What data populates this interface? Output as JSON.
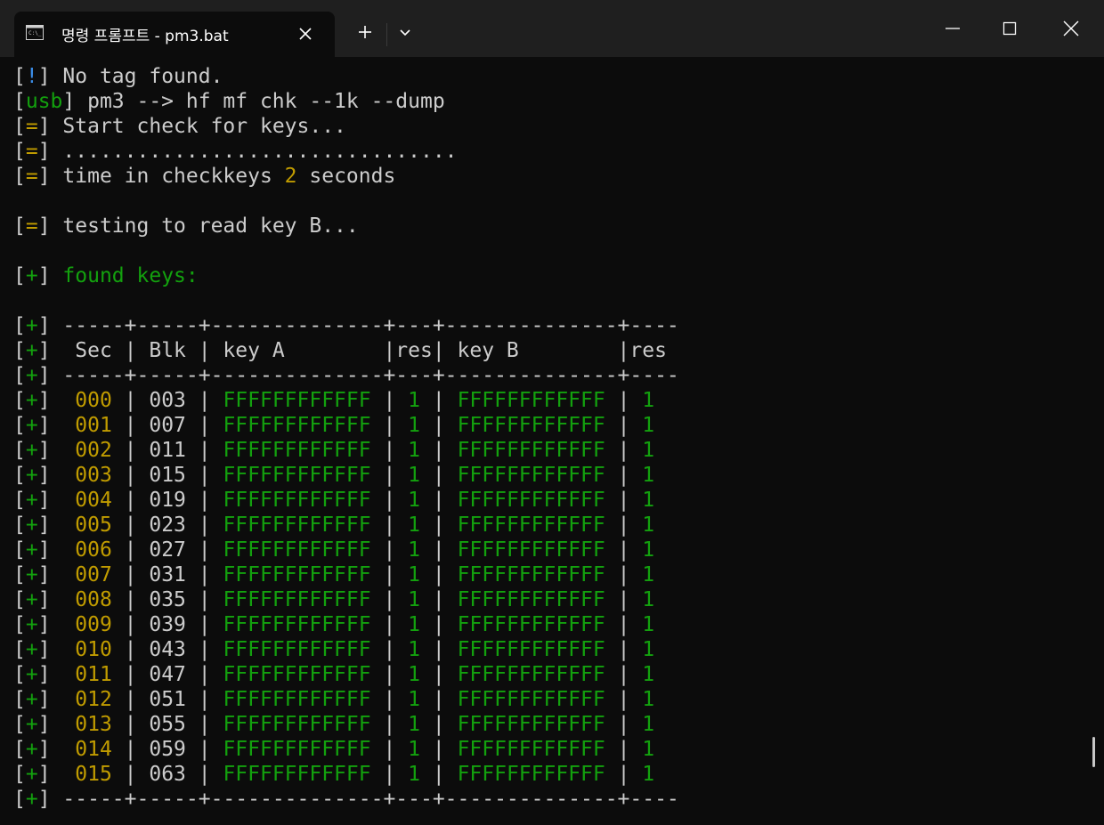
{
  "window": {
    "tab_title": "명령 프롬프트 - pm3.bat",
    "new_tab_label": "+",
    "icons": {
      "tab": "terminal-icon",
      "close_tab": "close-icon",
      "dropdown": "chevron-down-icon",
      "minimize": "minimize-icon",
      "maximize": "maximize-icon",
      "close_window": "close-icon"
    }
  },
  "colors": {
    "background": "#0c0c0c",
    "titlebar": "#1f1f1f",
    "text": "#cccccc",
    "green": "#13a10e",
    "yellow": "#c19c00",
    "blue": "#3b8eea"
  },
  "terminal": {
    "lines": [
      [
        {
          "t": "[",
          "c": "white"
        },
        {
          "t": "!",
          "c": "blue"
        },
        {
          "t": "] No tag found.",
          "c": "white"
        }
      ],
      [
        {
          "t": "[",
          "c": "white"
        },
        {
          "t": "usb",
          "c": "green"
        },
        {
          "t": "] pm3 --> hf mf chk --1k --dump",
          "c": "white"
        }
      ],
      [
        {
          "t": "[",
          "c": "white"
        },
        {
          "t": "=",
          "c": "yellow"
        },
        {
          "t": "] Start check for keys...",
          "c": "white"
        }
      ],
      [
        {
          "t": "[",
          "c": "white"
        },
        {
          "t": "=",
          "c": "yellow"
        },
        {
          "t": "] ................................",
          "c": "white"
        }
      ],
      [
        {
          "t": "[",
          "c": "white"
        },
        {
          "t": "=",
          "c": "yellow"
        },
        {
          "t": "] time in checkkeys ",
          "c": "white"
        },
        {
          "t": "2",
          "c": "yellow"
        },
        {
          "t": " seconds",
          "c": "white"
        }
      ],
      [],
      [
        {
          "t": "[",
          "c": "white"
        },
        {
          "t": "=",
          "c": "yellow"
        },
        {
          "t": "] testing to read key B...",
          "c": "white"
        }
      ],
      [],
      [
        {
          "t": "[",
          "c": "white"
        },
        {
          "t": "+",
          "c": "green"
        },
        {
          "t": "] ",
          "c": "white"
        },
        {
          "t": "found keys:",
          "c": "green"
        }
      ],
      [],
      [
        {
          "t": "[",
          "c": "white"
        },
        {
          "t": "+",
          "c": "green"
        },
        {
          "t": "] -----+-----+--------------+---+--------------+----",
          "c": "white"
        }
      ],
      [
        {
          "t": "[",
          "c": "white"
        },
        {
          "t": "+",
          "c": "green"
        },
        {
          "t": "]  Sec | Blk | key A        |res| key B        |res",
          "c": "white"
        }
      ],
      [
        {
          "t": "[",
          "c": "white"
        },
        {
          "t": "+",
          "c": "green"
        },
        {
          "t": "] -----+-----+--------------+---+--------------+----",
          "c": "white"
        }
      ],
      [
        {
          "t": "[",
          "c": "white"
        },
        {
          "t": "+",
          "c": "green"
        },
        {
          "t": "]  ",
          "c": "white"
        },
        {
          "t": "000",
          "c": "yellow"
        },
        {
          "t": " | 003 | ",
          "c": "white"
        },
        {
          "t": "FFFFFFFFFFFF",
          "c": "green"
        },
        {
          "t": " | ",
          "c": "white"
        },
        {
          "t": "1",
          "c": "green"
        },
        {
          "t": " | ",
          "c": "white"
        },
        {
          "t": "FFFFFFFFFFFF",
          "c": "green"
        },
        {
          "t": " | ",
          "c": "white"
        },
        {
          "t": "1",
          "c": "green"
        }
      ],
      [
        {
          "t": "[",
          "c": "white"
        },
        {
          "t": "+",
          "c": "green"
        },
        {
          "t": "]  ",
          "c": "white"
        },
        {
          "t": "001",
          "c": "yellow"
        },
        {
          "t": " | 007 | ",
          "c": "white"
        },
        {
          "t": "FFFFFFFFFFFF",
          "c": "green"
        },
        {
          "t": " | ",
          "c": "white"
        },
        {
          "t": "1",
          "c": "green"
        },
        {
          "t": " | ",
          "c": "white"
        },
        {
          "t": "FFFFFFFFFFFF",
          "c": "green"
        },
        {
          "t": " | ",
          "c": "white"
        },
        {
          "t": "1",
          "c": "green"
        }
      ],
      [
        {
          "t": "[",
          "c": "white"
        },
        {
          "t": "+",
          "c": "green"
        },
        {
          "t": "]  ",
          "c": "white"
        },
        {
          "t": "002",
          "c": "yellow"
        },
        {
          "t": " | 011 | ",
          "c": "white"
        },
        {
          "t": "FFFFFFFFFFFF",
          "c": "green"
        },
        {
          "t": " | ",
          "c": "white"
        },
        {
          "t": "1",
          "c": "green"
        },
        {
          "t": " | ",
          "c": "white"
        },
        {
          "t": "FFFFFFFFFFFF",
          "c": "green"
        },
        {
          "t": " | ",
          "c": "white"
        },
        {
          "t": "1",
          "c": "green"
        }
      ],
      [
        {
          "t": "[",
          "c": "white"
        },
        {
          "t": "+",
          "c": "green"
        },
        {
          "t": "]  ",
          "c": "white"
        },
        {
          "t": "003",
          "c": "yellow"
        },
        {
          "t": " | 015 | ",
          "c": "white"
        },
        {
          "t": "FFFFFFFFFFFF",
          "c": "green"
        },
        {
          "t": " | ",
          "c": "white"
        },
        {
          "t": "1",
          "c": "green"
        },
        {
          "t": " | ",
          "c": "white"
        },
        {
          "t": "FFFFFFFFFFFF",
          "c": "green"
        },
        {
          "t": " | ",
          "c": "white"
        },
        {
          "t": "1",
          "c": "green"
        }
      ],
      [
        {
          "t": "[",
          "c": "white"
        },
        {
          "t": "+",
          "c": "green"
        },
        {
          "t": "]  ",
          "c": "white"
        },
        {
          "t": "004",
          "c": "yellow"
        },
        {
          "t": " | 019 | ",
          "c": "white"
        },
        {
          "t": "FFFFFFFFFFFF",
          "c": "green"
        },
        {
          "t": " | ",
          "c": "white"
        },
        {
          "t": "1",
          "c": "green"
        },
        {
          "t": " | ",
          "c": "white"
        },
        {
          "t": "FFFFFFFFFFFF",
          "c": "green"
        },
        {
          "t": " | ",
          "c": "white"
        },
        {
          "t": "1",
          "c": "green"
        }
      ],
      [
        {
          "t": "[",
          "c": "white"
        },
        {
          "t": "+",
          "c": "green"
        },
        {
          "t": "]  ",
          "c": "white"
        },
        {
          "t": "005",
          "c": "yellow"
        },
        {
          "t": " | 023 | ",
          "c": "white"
        },
        {
          "t": "FFFFFFFFFFFF",
          "c": "green"
        },
        {
          "t": " | ",
          "c": "white"
        },
        {
          "t": "1",
          "c": "green"
        },
        {
          "t": " | ",
          "c": "white"
        },
        {
          "t": "FFFFFFFFFFFF",
          "c": "green"
        },
        {
          "t": " | ",
          "c": "white"
        },
        {
          "t": "1",
          "c": "green"
        }
      ],
      [
        {
          "t": "[",
          "c": "white"
        },
        {
          "t": "+",
          "c": "green"
        },
        {
          "t": "]  ",
          "c": "white"
        },
        {
          "t": "006",
          "c": "yellow"
        },
        {
          "t": " | 027 | ",
          "c": "white"
        },
        {
          "t": "FFFFFFFFFFFF",
          "c": "green"
        },
        {
          "t": " | ",
          "c": "white"
        },
        {
          "t": "1",
          "c": "green"
        },
        {
          "t": " | ",
          "c": "white"
        },
        {
          "t": "FFFFFFFFFFFF",
          "c": "green"
        },
        {
          "t": " | ",
          "c": "white"
        },
        {
          "t": "1",
          "c": "green"
        }
      ],
      [
        {
          "t": "[",
          "c": "white"
        },
        {
          "t": "+",
          "c": "green"
        },
        {
          "t": "]  ",
          "c": "white"
        },
        {
          "t": "007",
          "c": "yellow"
        },
        {
          "t": " | 031 | ",
          "c": "white"
        },
        {
          "t": "FFFFFFFFFFFF",
          "c": "green"
        },
        {
          "t": " | ",
          "c": "white"
        },
        {
          "t": "1",
          "c": "green"
        },
        {
          "t": " | ",
          "c": "white"
        },
        {
          "t": "FFFFFFFFFFFF",
          "c": "green"
        },
        {
          "t": " | ",
          "c": "white"
        },
        {
          "t": "1",
          "c": "green"
        }
      ],
      [
        {
          "t": "[",
          "c": "white"
        },
        {
          "t": "+",
          "c": "green"
        },
        {
          "t": "]  ",
          "c": "white"
        },
        {
          "t": "008",
          "c": "yellow"
        },
        {
          "t": " | 035 | ",
          "c": "white"
        },
        {
          "t": "FFFFFFFFFFFF",
          "c": "green"
        },
        {
          "t": " | ",
          "c": "white"
        },
        {
          "t": "1",
          "c": "green"
        },
        {
          "t": " | ",
          "c": "white"
        },
        {
          "t": "FFFFFFFFFFFF",
          "c": "green"
        },
        {
          "t": " | ",
          "c": "white"
        },
        {
          "t": "1",
          "c": "green"
        }
      ],
      [
        {
          "t": "[",
          "c": "white"
        },
        {
          "t": "+",
          "c": "green"
        },
        {
          "t": "]  ",
          "c": "white"
        },
        {
          "t": "009",
          "c": "yellow"
        },
        {
          "t": " | 039 | ",
          "c": "white"
        },
        {
          "t": "FFFFFFFFFFFF",
          "c": "green"
        },
        {
          "t": " | ",
          "c": "white"
        },
        {
          "t": "1",
          "c": "green"
        },
        {
          "t": " | ",
          "c": "white"
        },
        {
          "t": "FFFFFFFFFFFF",
          "c": "green"
        },
        {
          "t": " | ",
          "c": "white"
        },
        {
          "t": "1",
          "c": "green"
        }
      ],
      [
        {
          "t": "[",
          "c": "white"
        },
        {
          "t": "+",
          "c": "green"
        },
        {
          "t": "]  ",
          "c": "white"
        },
        {
          "t": "010",
          "c": "yellow"
        },
        {
          "t": " | 043 | ",
          "c": "white"
        },
        {
          "t": "FFFFFFFFFFFF",
          "c": "green"
        },
        {
          "t": " | ",
          "c": "white"
        },
        {
          "t": "1",
          "c": "green"
        },
        {
          "t": " | ",
          "c": "white"
        },
        {
          "t": "FFFFFFFFFFFF",
          "c": "green"
        },
        {
          "t": " | ",
          "c": "white"
        },
        {
          "t": "1",
          "c": "green"
        }
      ],
      [
        {
          "t": "[",
          "c": "white"
        },
        {
          "t": "+",
          "c": "green"
        },
        {
          "t": "]  ",
          "c": "white"
        },
        {
          "t": "011",
          "c": "yellow"
        },
        {
          "t": " | 047 | ",
          "c": "white"
        },
        {
          "t": "FFFFFFFFFFFF",
          "c": "green"
        },
        {
          "t": " | ",
          "c": "white"
        },
        {
          "t": "1",
          "c": "green"
        },
        {
          "t": " | ",
          "c": "white"
        },
        {
          "t": "FFFFFFFFFFFF",
          "c": "green"
        },
        {
          "t": " | ",
          "c": "white"
        },
        {
          "t": "1",
          "c": "green"
        }
      ],
      [
        {
          "t": "[",
          "c": "white"
        },
        {
          "t": "+",
          "c": "green"
        },
        {
          "t": "]  ",
          "c": "white"
        },
        {
          "t": "012",
          "c": "yellow"
        },
        {
          "t": " | 051 | ",
          "c": "white"
        },
        {
          "t": "FFFFFFFFFFFF",
          "c": "green"
        },
        {
          "t": " | ",
          "c": "white"
        },
        {
          "t": "1",
          "c": "green"
        },
        {
          "t": " | ",
          "c": "white"
        },
        {
          "t": "FFFFFFFFFFFF",
          "c": "green"
        },
        {
          "t": " | ",
          "c": "white"
        },
        {
          "t": "1",
          "c": "green"
        }
      ],
      [
        {
          "t": "[",
          "c": "white"
        },
        {
          "t": "+",
          "c": "green"
        },
        {
          "t": "]  ",
          "c": "white"
        },
        {
          "t": "013",
          "c": "yellow"
        },
        {
          "t": " | 055 | ",
          "c": "white"
        },
        {
          "t": "FFFFFFFFFFFF",
          "c": "green"
        },
        {
          "t": " | ",
          "c": "white"
        },
        {
          "t": "1",
          "c": "green"
        },
        {
          "t": " | ",
          "c": "white"
        },
        {
          "t": "FFFFFFFFFFFF",
          "c": "green"
        },
        {
          "t": " | ",
          "c": "white"
        },
        {
          "t": "1",
          "c": "green"
        }
      ],
      [
        {
          "t": "[",
          "c": "white"
        },
        {
          "t": "+",
          "c": "green"
        },
        {
          "t": "]  ",
          "c": "white"
        },
        {
          "t": "014",
          "c": "yellow"
        },
        {
          "t": " | 059 | ",
          "c": "white"
        },
        {
          "t": "FFFFFFFFFFFF",
          "c": "green"
        },
        {
          "t": " | ",
          "c": "white"
        },
        {
          "t": "1",
          "c": "green"
        },
        {
          "t": " | ",
          "c": "white"
        },
        {
          "t": "FFFFFFFFFFFF",
          "c": "green"
        },
        {
          "t": " | ",
          "c": "white"
        },
        {
          "t": "1",
          "c": "green"
        }
      ],
      [
        {
          "t": "[",
          "c": "white"
        },
        {
          "t": "+",
          "c": "green"
        },
        {
          "t": "]  ",
          "c": "white"
        },
        {
          "t": "015",
          "c": "yellow"
        },
        {
          "t": " | 063 | ",
          "c": "white"
        },
        {
          "t": "FFFFFFFFFFFF",
          "c": "green"
        },
        {
          "t": " | ",
          "c": "white"
        },
        {
          "t": "1",
          "c": "green"
        },
        {
          "t": " | ",
          "c": "white"
        },
        {
          "t": "FFFFFFFFFFFF",
          "c": "green"
        },
        {
          "t": " | ",
          "c": "white"
        },
        {
          "t": "1",
          "c": "green"
        }
      ],
      [
        {
          "t": "[",
          "c": "white"
        },
        {
          "t": "+",
          "c": "green"
        },
        {
          "t": "] -----+-----+--------------+---+--------------+----",
          "c": "white"
        }
      ]
    ]
  }
}
